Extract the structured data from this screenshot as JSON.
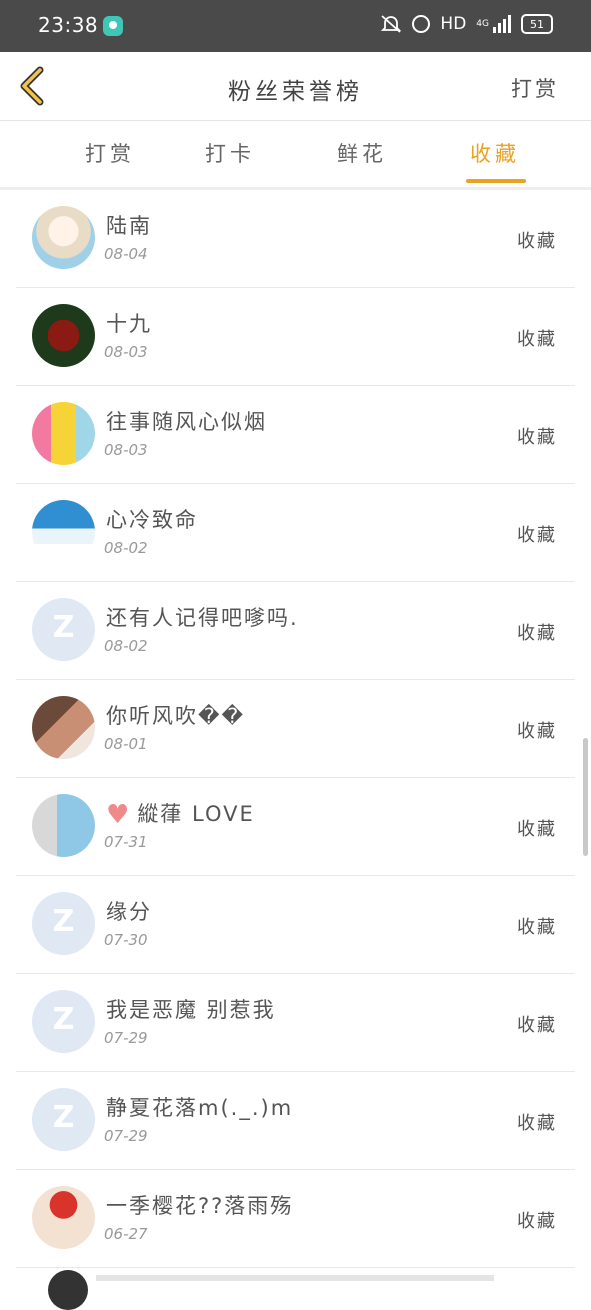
{
  "status": {
    "time": "23:38",
    "hd": "HD",
    "net": "4G",
    "battery": "51"
  },
  "header": {
    "title": "粉丝荣誉榜",
    "action": "打赏"
  },
  "tabs": [
    {
      "label": "打赏"
    },
    {
      "label": "打卡"
    },
    {
      "label": "鲜花"
    },
    {
      "label": "收藏"
    }
  ],
  "active_tab": "收藏",
  "entries": [
    {
      "name": "陆南",
      "date": "08-04",
      "type": "收藏",
      "avatar": "anime-boy"
    },
    {
      "name": "十九",
      "date": "08-03",
      "type": "收藏",
      "avatar": "red-character"
    },
    {
      "name": "往事随风心似烟",
      "date": "08-03",
      "type": "收藏",
      "avatar": "yellow-dress"
    },
    {
      "name": "心冷致命",
      "date": "08-02",
      "type": "收藏",
      "avatar": "blue-scene"
    },
    {
      "name": "还有人记得吧嗲吗.",
      "date": "08-02",
      "type": "收藏",
      "avatar": "default"
    },
    {
      "name": "你听风吹��",
      "date": "08-01",
      "type": "收藏",
      "avatar": "couple"
    },
    {
      "name": "縱葎 LOVE",
      "date": "07-31",
      "type": "收藏",
      "avatar": "girl",
      "heart": "♥"
    },
    {
      "name": "缘分",
      "date": "07-30",
      "type": "收藏",
      "avatar": "default"
    },
    {
      "name": "我是恶魔 别惹我",
      "date": "07-29",
      "type": "收藏",
      "avatar": "default"
    },
    {
      "name": "静夏花落m(._.)m",
      "date": "07-29",
      "type": "收藏",
      "avatar": "default"
    },
    {
      "name": "一季樱花??落雨殇",
      "date": "06-27",
      "type": "收藏",
      "avatar": "sakura"
    }
  ]
}
